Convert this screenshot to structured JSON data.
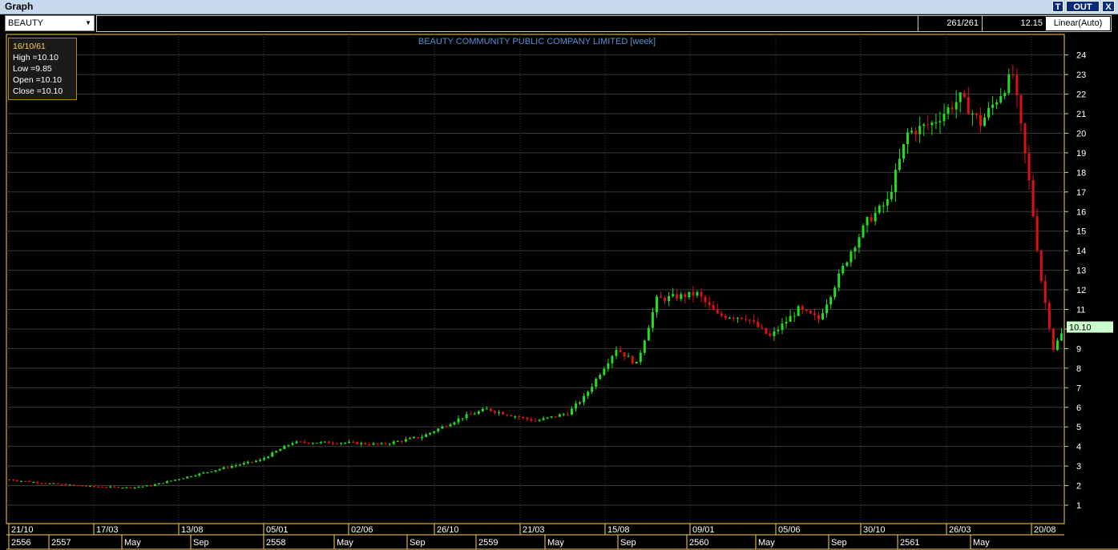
{
  "window": {
    "title": "Graph",
    "btn_t": "T",
    "btn_out": "OUT",
    "btn_x": "X"
  },
  "toolbar": {
    "symbol": "BEAUTY",
    "count": "261/261",
    "last": "12.15",
    "scale": "Linear(Auto)"
  },
  "tooltip": {
    "date": "16/10/61",
    "high": "High  =10.10",
    "low": "Low   =9.85",
    "open": "Open  =10.10",
    "close": "Close  =10.10"
  },
  "chart_data": {
    "type": "candlestick",
    "title": "BEAUTY COMMUNITY PUBLIC COMPANY LIMITED [week]",
    "ylim": [
      0,
      25
    ],
    "yticks": [
      1,
      2,
      3,
      4,
      5,
      6,
      7,
      8,
      9,
      10,
      11,
      12,
      13,
      14,
      15,
      16,
      17,
      18,
      19,
      20,
      21,
      22,
      23,
      24
    ],
    "last_value_label": "10.10",
    "n_bars": 261,
    "x_date_labels": [
      "21/10",
      "17/03",
      "13/08",
      "05/01",
      "02/06",
      "26/10",
      "21/03",
      "15/08",
      "09/01",
      "05/06",
      "30/10",
      "26/03",
      "20/08"
    ],
    "x_period_labels": [
      "2556",
      "2557",
      "May",
      "Sep",
      "2558",
      "May",
      "Sep",
      "2559",
      "May",
      "Sep",
      "2560",
      "May",
      "Sep",
      "2561",
      "May"
    ],
    "close_trend_approx": [
      [
        0,
        2.3
      ],
      [
        10,
        2.1
      ],
      [
        20,
        1.95
      ],
      [
        30,
        1.9
      ],
      [
        35,
        2.0
      ],
      [
        45,
        2.5
      ],
      [
        55,
        3.0
      ],
      [
        62,
        3.3
      ],
      [
        70,
        4.2
      ],
      [
        82,
        4.2
      ],
      [
        92,
        4.1
      ],
      [
        102,
        4.5
      ],
      [
        112,
        5.5
      ],
      [
        118,
        5.9
      ],
      [
        130,
        5.3
      ],
      [
        138,
        5.7
      ],
      [
        142,
        6.5
      ],
      [
        150,
        9.0
      ],
      [
        155,
        8.2
      ],
      [
        160,
        11.5
      ],
      [
        170,
        11.8
      ],
      [
        175,
        10.7
      ],
      [
        182,
        10.6
      ],
      [
        188,
        9.6
      ],
      [
        195,
        11.0
      ],
      [
        200,
        10.5
      ],
      [
        208,
        14.0
      ],
      [
        212,
        15.5
      ],
      [
        217,
        16.5
      ],
      [
        222,
        20.0
      ],
      [
        228,
        20.5
      ],
      [
        235,
        21.8
      ],
      [
        240,
        20.5
      ],
      [
        248,
        23.0
      ],
      [
        252,
        17.5
      ],
      [
        255,
        12.5
      ],
      [
        258,
        9.0
      ],
      [
        261,
        10.1
      ]
    ],
    "colors": {
      "up": "#22dd22",
      "down": "#e01010",
      "grid": "#3a3a3a",
      "axis": "#ffd24a",
      "title": "#5b8fd6"
    }
  }
}
